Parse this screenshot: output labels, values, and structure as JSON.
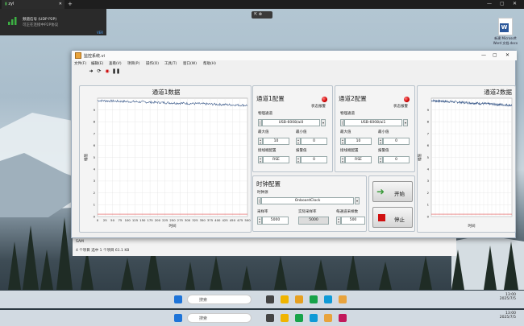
{
  "top_bar": {
    "tab_label": "zyl",
    "new_tab": "+"
  },
  "toast": {
    "title": "频道信号 (UDP P2P)",
    "subtitle": "可正在连接中P2P协议",
    "version": "VER"
  },
  "remote_bar": {
    "label": "⇱ ⊗"
  },
  "desktop_file": {
    "label": "新建 Microsoft Word 文档.docx",
    "icon_letter": "W"
  },
  "explorer": {
    "item_name": "SAM",
    "status": "4 个项目   选中 1 个项目  61.1 KB"
  },
  "app": {
    "title": "监控系统.vi",
    "menu": [
      "文件(F)",
      "编辑(E)",
      "查看(V)",
      "项目(P)",
      "操作(O)",
      "工具(T)",
      "窗口(W)",
      "帮助(H)"
    ],
    "toolbar_icons": [
      "run-arrow-icon",
      "run-continuous-icon",
      "abort-icon",
      "pause-icon"
    ],
    "chart1": {
      "title": "通道1数据",
      "ylabel": "幅值",
      "xlabel": "时间"
    },
    "chart2": {
      "title": "通道2数据",
      "ylabel": "幅值",
      "xlabel": "时间"
    },
    "ch1": {
      "title": "通道1配置",
      "status_label": "状态报警",
      "physical_channel_label": "物理通道",
      "physical_channel": "USB-6008/ai0",
      "max_label": "最大值",
      "max": "10",
      "min_label": "最小值",
      "min": "0",
      "terminal_label": "接线端配置",
      "terminal": "RSE",
      "alarm_label": "报警值",
      "alarm": "0"
    },
    "ch2": {
      "title": "通道2配置",
      "status_label": "状态报警",
      "physical_channel_label": "物理通道",
      "physical_channel": "USB-6008/ai1",
      "max_label": "最大值",
      "max": "10",
      "min_label": "最小值",
      "min": "0",
      "terminal_label": "接线端配置",
      "terminal": "RSE",
      "alarm_label": "报警值",
      "alarm": "0"
    },
    "clock": {
      "title": "时钟配置",
      "source_label": "时钟源",
      "source": "OnboardClock",
      "rate_label": "采样率",
      "rate": "5000",
      "actual_rate_label": "实际采样率",
      "actual_rate": "5000",
      "samples_label": "每通道采样数",
      "samples": "500"
    },
    "start_label": "开始",
    "stop_label": "停止",
    "colors": {
      "start_arrow": "#3a9a3a",
      "stop_square": "#d01010",
      "led": "#cc0000",
      "trace": "#3b5a8a",
      "threshold": "#e05050"
    }
  },
  "chart_data": [
    {
      "type": "line",
      "title": "通道1数据",
      "xlabel": "时间",
      "ylabel": "幅值",
      "xlim": [
        0,
        500
      ],
      "ylim": [
        0,
        10
      ],
      "xticks": [
        "0",
        "25",
        "50",
        "75",
        "100",
        "125",
        "150",
        "175",
        "200",
        "225",
        "250",
        "275",
        "300",
        "325",
        "350",
        "375",
        "400",
        "425",
        "450",
        "475",
        "500"
      ],
      "yticks": [
        "0",
        "1",
        "2",
        "3",
        "4",
        "5",
        "6",
        "7",
        "8",
        "9"
      ],
      "series": [
        {
          "values_start": 9.8,
          "values_end": 9.4,
          "noise": 0.1
        }
      ],
      "threshold": 0.2
    },
    {
      "type": "line",
      "title": "通道2数据",
      "xlabel": "时间",
      "ylabel": "幅值",
      "xlim": [
        0,
        500
      ],
      "ylim": [
        0,
        10
      ],
      "xticks": [
        "0",
        "25",
        "50",
        "75",
        "100",
        "125",
        "150",
        "175",
        "200",
        "225",
        "250",
        "275",
        "300",
        "325",
        "350",
        "375",
        "400",
        "425",
        "450",
        "475",
        "500"
      ],
      "yticks": [
        "0",
        "1",
        "2",
        "3",
        "4",
        "5",
        "6",
        "7",
        "8",
        "9"
      ],
      "series": [
        {
          "values_start": 9.8,
          "values_end": 9.4,
          "noise": 0.1
        }
      ],
      "threshold": 0.2
    }
  ],
  "taskbar": {
    "search_placeholder": "搜索",
    "time": "13:00",
    "date": "2025/7/5"
  }
}
